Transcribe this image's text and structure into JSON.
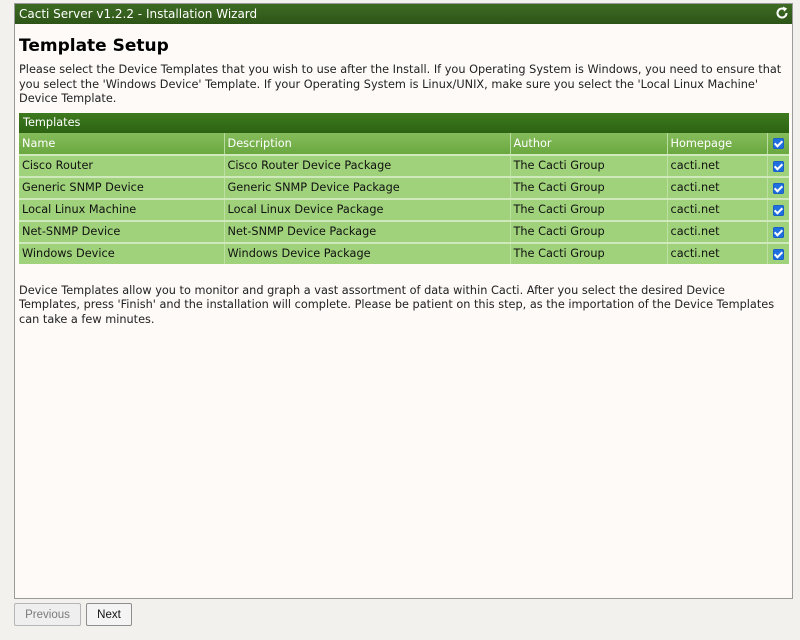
{
  "window": {
    "title": "Cacti Server v1.2.2 - Installation Wizard",
    "refresh_icon": "refresh-icon"
  },
  "page": {
    "title": "Template Setup",
    "intro": "Please select the Device Templates that you wish to use after the Install. If you Operating System is Windows, you need to ensure that you select the 'Windows Device' Template. If your Operating System is Linux/UNIX, make sure you select the 'Local Linux Machine' Device Template.",
    "outro": "Device Templates allow you to monitor and graph a vast assortment of data within Cacti. After you select the desired Device Templates, press 'Finish' and the installation will complete. Please be patient on this step, as the importation of the Device Templates can take a few minutes."
  },
  "templates": {
    "section_title": "Templates",
    "columns": [
      "Name",
      "Description",
      "Author",
      "Homepage"
    ],
    "select_all_checked": true,
    "rows": [
      {
        "name": "Cisco Router",
        "description": "Cisco Router Device Package",
        "author": "The Cacti Group",
        "homepage": "cacti.net",
        "checked": true
      },
      {
        "name": "Generic SNMP Device",
        "description": "Generic SNMP Device Package",
        "author": "The Cacti Group",
        "homepage": "cacti.net",
        "checked": true
      },
      {
        "name": "Local Linux Machine",
        "description": "Local Linux Device Package",
        "author": "The Cacti Group",
        "homepage": "cacti.net",
        "checked": true
      },
      {
        "name": "Net-SNMP Device",
        "description": "Net-SNMP Device Package",
        "author": "The Cacti Group",
        "homepage": "cacti.net",
        "checked": true
      },
      {
        "name": "Windows Device",
        "description": "Windows Device Package",
        "author": "The Cacti Group",
        "homepage": "cacti.net",
        "checked": true
      }
    ]
  },
  "buttons": {
    "previous": "Previous",
    "next": "Next"
  },
  "colors": {
    "titlebar": "#2d5417",
    "row_fill": "#9fd27a",
    "checkbox": "#1f6fe0"
  }
}
